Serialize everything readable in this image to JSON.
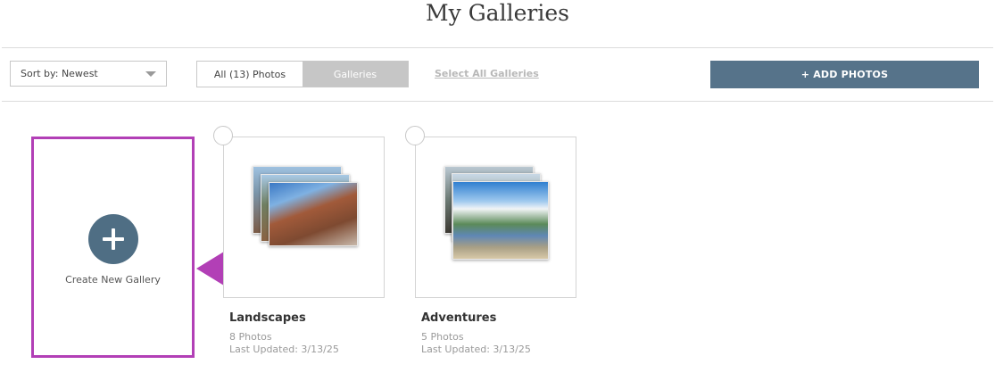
{
  "header": {
    "title": "My Galleries"
  },
  "toolbar": {
    "sort_label": "Sort by: Newest",
    "view_photos_label": "All (13) Photos",
    "view_galleries_label": "Galleries",
    "select_all_label": "Select All Galleries",
    "add_photos_label": "+ ADD PHOTOS"
  },
  "create_card": {
    "label": "Create New Gallery",
    "icon": "plus-icon"
  },
  "galleries": [
    {
      "name": "Landscapes",
      "count_label": "8 Photos",
      "updated_label": "Last Updated: 3/13/25"
    },
    {
      "name": "Adventures",
      "count_label": "5 Photos",
      "updated_label": "Last Updated: 3/13/25"
    }
  ],
  "colors": {
    "accent": "#56738a",
    "highlight": "#b23fb6",
    "active_tab": "#c6c6c6"
  }
}
